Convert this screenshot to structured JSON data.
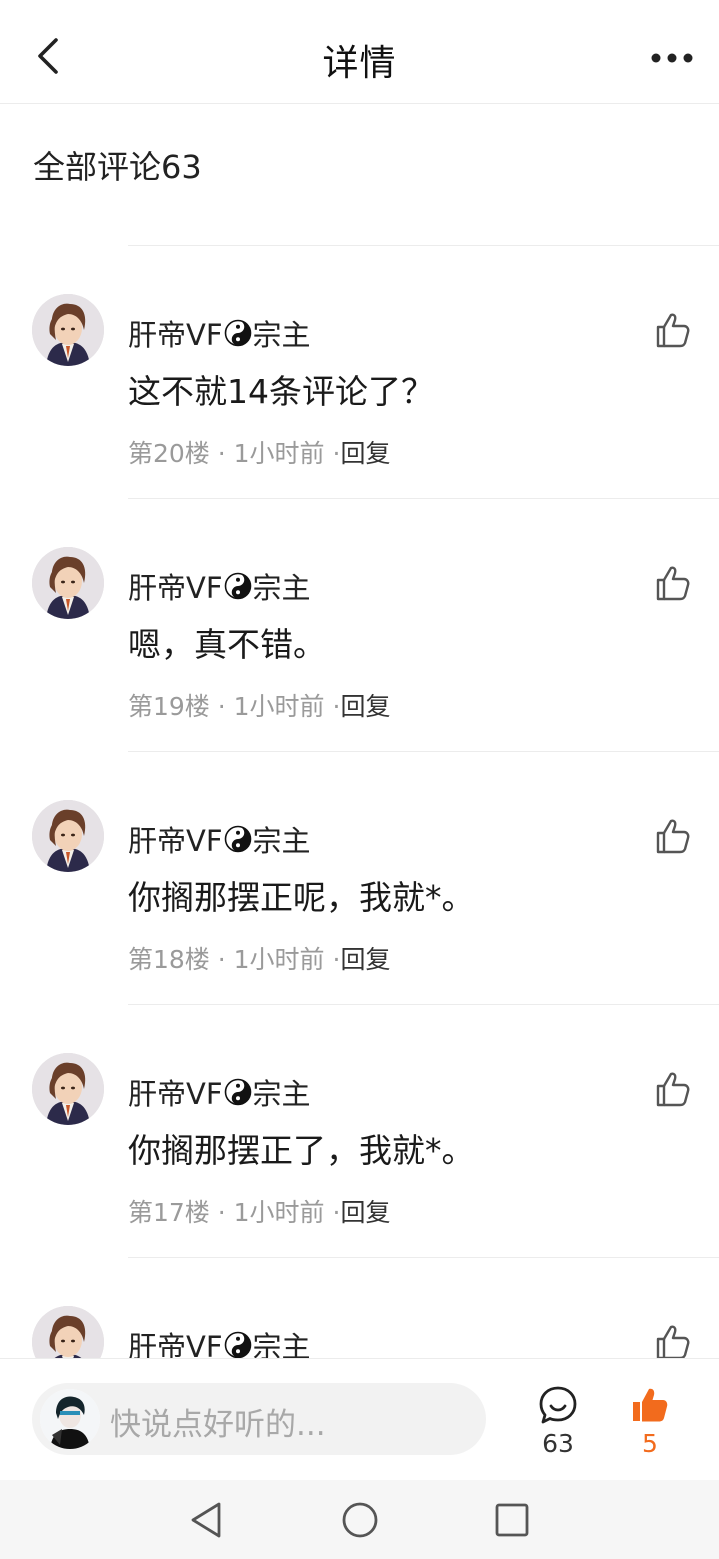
{
  "header": {
    "title": "详情"
  },
  "section": {
    "title": "全部评论63"
  },
  "comments": [
    {
      "author_prefix": "肝帝VF",
      "author_suffix": "宗主",
      "text": "这不就14条评论了？",
      "floor": "第20楼",
      "time": "1小时前",
      "reply": "回复"
    },
    {
      "author_prefix": "肝帝VF",
      "author_suffix": "宗主",
      "text": "嗯，真不错。",
      "floor": "第19楼",
      "time": "1小时前",
      "reply": "回复"
    },
    {
      "author_prefix": "肝帝VF",
      "author_suffix": "宗主",
      "text": "你搁那摆正呢，我就*。",
      "floor": "第18楼",
      "time": "1小时前",
      "reply": "回复"
    },
    {
      "author_prefix": "肝帝VF",
      "author_suffix": "宗主",
      "text": "你搁那摆正了，我就*。",
      "floor": "第17楼",
      "time": "1小时前",
      "reply": "回复"
    },
    {
      "author_prefix": "肝帝VF",
      "author_suffix": "宗主",
      "text": "",
      "floor": "",
      "time": "",
      "reply": ""
    }
  ],
  "bottom": {
    "placeholder": "快说点好听的...",
    "comment_count": "63",
    "like_count": "5",
    "like_color": "#f26b1d"
  },
  "icons": {
    "back": "chevron-left-icon",
    "more": "more-horizontal-icon",
    "like": "thumbs-up-icon",
    "comment": "chat-bubble-icon",
    "yinyang": "yin-yang-icon"
  }
}
